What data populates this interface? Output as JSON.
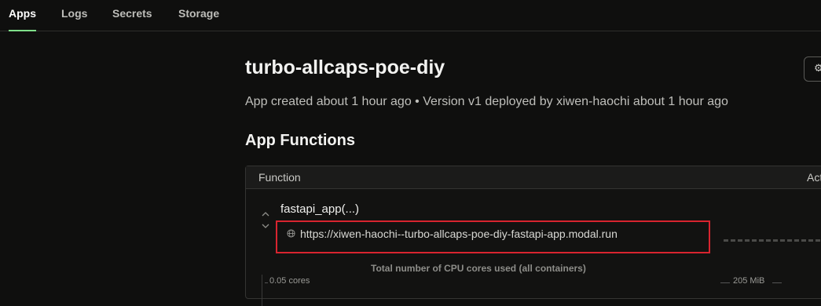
{
  "nav": {
    "tabs": [
      {
        "label": "Apps",
        "active": true
      },
      {
        "label": "Logs",
        "active": false
      },
      {
        "label": "Secrets",
        "active": false
      },
      {
        "label": "Storage",
        "active": false
      }
    ],
    "accent_color": "#7fe08a"
  },
  "app": {
    "title": "turbo-allcaps-poe-diy",
    "subtitle": "App created about 1 hour ago • Version v1 deployed by xiwen-haochi about 1 hour ago"
  },
  "functions": {
    "section_title": "App Functions",
    "columns": {
      "function": "Function",
      "active": "Act"
    },
    "rows": [
      {
        "name": "fastapi_app(...)",
        "url": "https://xiwen-haochi--turbo-allcaps-poe-diy-fastapi-app.modal.run",
        "url_icon": "globe-icon",
        "highlight_color": "#d8242f"
      }
    ],
    "chart": {
      "title": "Total number of CPU cores used (all containers)",
      "left_tick": "0.05 cores",
      "right_tick": "205 MiB"
    }
  }
}
